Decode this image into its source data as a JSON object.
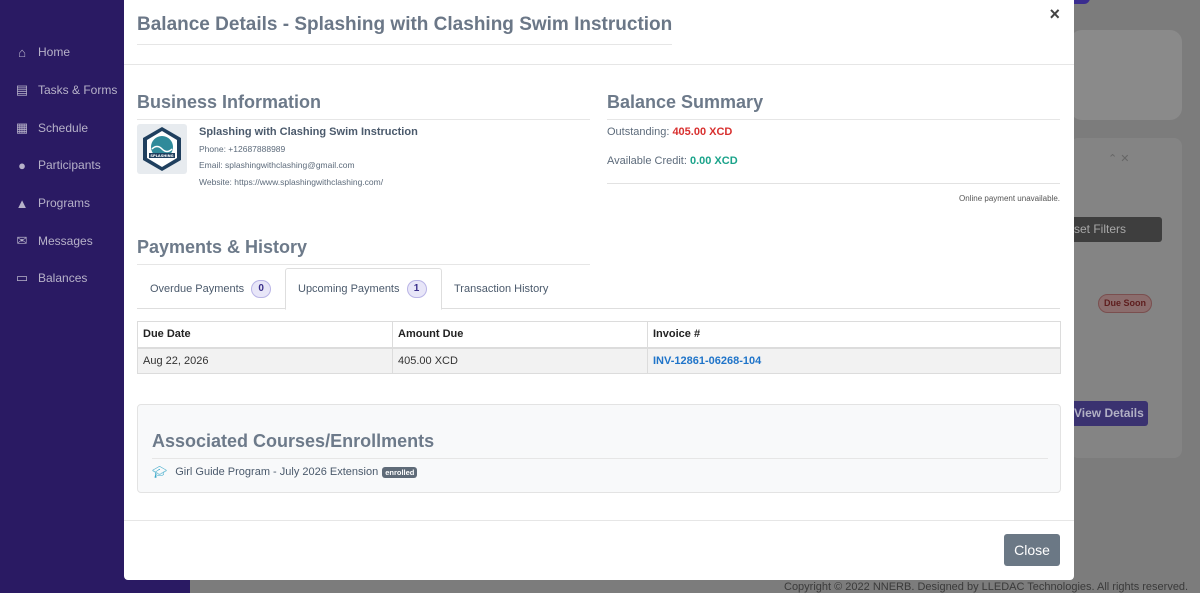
{
  "background": {
    "sidebar": {
      "items": [
        {
          "label": "Home",
          "icon": "home-icon"
        },
        {
          "label": "Tasks & Forms",
          "icon": "clipboard-icon"
        },
        {
          "label": "Schedule",
          "icon": "calendar-icon"
        },
        {
          "label": "Participants",
          "icon": "users-icon"
        },
        {
          "label": "Programs",
          "icon": "graduation-cap-icon"
        },
        {
          "label": "Messages",
          "icon": "envelope-icon"
        },
        {
          "label": "Balances",
          "icon": "credit-card-icon"
        }
      ]
    },
    "reset_filters_label": "set Filters",
    "due_soon_label": "Due Soon",
    "view_details_label": "View Details",
    "copyright": "Copyright © 2022 NNERB. Designed by LLEDAC Technologies. All rights reserved."
  },
  "modal": {
    "title": "Balance Details - Splashing with Clashing Swim Instruction",
    "close_symbol": "×",
    "business": {
      "heading": "Business Information",
      "logo_text": "SPLASHING",
      "name": "Splashing with Clashing Swim Instruction",
      "phone": "Phone: +12687888989",
      "email": "Email: splashingwithclashing@gmail.com",
      "website": "Website: https://www.splashingwithclashing.com/"
    },
    "balance": {
      "heading": "Balance Summary",
      "outstanding_label": "Outstanding:",
      "outstanding_value": "405.00 XCD",
      "credit_label": "Available Credit:",
      "credit_value": "0.00 XCD",
      "online_note": "Online payment unavailable."
    },
    "payments": {
      "heading": "Payments & History",
      "tabs": [
        {
          "label": "Overdue Payments",
          "count": "0"
        },
        {
          "label": "Upcoming Payments",
          "count": "1"
        },
        {
          "label": "Transaction History"
        }
      ],
      "columns": [
        "Due Date",
        "Amount Due",
        "Invoice #"
      ],
      "rows": [
        {
          "due_date": "Aug 22, 2026",
          "amount": "405.00 XCD",
          "invoice": "INV-12861-06268-104"
        }
      ]
    },
    "associated": {
      "heading": "Associated Courses/Enrollments",
      "items": [
        {
          "name": "Girl Guide Program - July 2026 Extension",
          "status": "enrolled"
        }
      ]
    },
    "close_button": "Close"
  },
  "colors": {
    "sidebar": "#2a1a63",
    "outstanding": "#d8302f",
    "credit": "#1aa38a",
    "link": "#1f74c9"
  }
}
